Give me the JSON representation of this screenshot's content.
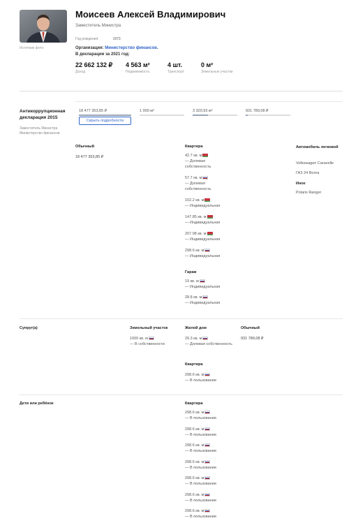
{
  "person": {
    "name": "Моисеев Алексей Владимирович",
    "position": "Заместитель Министра",
    "birth_label": "Год рождения:",
    "birth_year": "1973",
    "photo_caption": "Источник фото",
    "org_label": "Организация:",
    "org_name": "Министерство финансов",
    "org_suffix": ".",
    "decl_label": "В декларации за 2021 год:"
  },
  "summary": [
    {
      "value": "22 662 132 ₽",
      "label": "Доход"
    },
    {
      "value": "4 563 м²",
      "label": "Недвижимость"
    },
    {
      "value": "4 шт.",
      "label": "Транспорт"
    },
    {
      "value": "0 м²",
      "label": "Земельные участки"
    }
  ],
  "declaration": {
    "title": "Антикоррупционная декларация 2015",
    "position": "Заместитель Министра",
    "org": "Министерство финансов",
    "bars": [
      {
        "value": "18 477 353,85 ₽",
        "fill": 1.0
      },
      {
        "value": "1 000 м²",
        "fill": 0.0
      },
      {
        "value": "3 320,93 м²",
        "fill": 0.35
      },
      {
        "value": "931 789,08 ₽",
        "fill": 0.05
      }
    ],
    "toggle_button": "Скрыть подробности",
    "self": {
      "income_head": "Обычный",
      "income_value": "18 477 353,85 ₽",
      "apartments_head": "Квартира",
      "apartments": [
        {
          "area": "42.7 кв. м",
          "flag": "by",
          "type": "— Долевая собственность"
        },
        {
          "area": "57.7 кв. м",
          "flag": "ru",
          "type": "— Долевая собственность"
        },
        {
          "area": "102.2 кв. м",
          "flag": "by",
          "type": "— Индивидуальная"
        },
        {
          "area": "147.85 кв. м",
          "flag": "by",
          "type": "— Индивидуальная"
        },
        {
          "area": "207.98 кв. м",
          "flag": "by",
          "type": "— Индивидуальная"
        },
        {
          "area": "298.6 кв. м",
          "flag": "ru",
          "type": "— Индивидуальная"
        }
      ],
      "garage_head": "Гараж",
      "garages": [
        {
          "area": "19 кв. м",
          "flag": "ru",
          "type": "— Индивидуальная"
        },
        {
          "area": "28.8 кв. м",
          "flag": "ru",
          "type": "— Индивидуальная"
        }
      ],
      "vehicles_head": "Автомобиль легковой",
      "cars": [
        "Volkswagen Caravelle",
        "ГАЗ 24 Волга"
      ],
      "other_head": "Иное",
      "other": [
        "Polaris Ranger"
      ]
    },
    "spouse": {
      "label": "Супруг(а)",
      "land_head": "Земельный участок",
      "land": {
        "area": "1000 кв. м",
        "flag": "ru",
        "type": "— В собственности"
      },
      "house_head": "Жилой дом",
      "house": {
        "area": "29.3 кв. м",
        "flag": "ru",
        "type": "— Долевая собственность"
      },
      "apartment_head": "Квартира",
      "apartment": {
        "area": "298.6 кв. м",
        "flag": "ru",
        "type": "— В пользовании"
      },
      "income_head": "Обычный",
      "income_value": "931 789,08 ₽"
    },
    "children": {
      "label": "Дети или ребёнок",
      "apartment_head": "Квартира",
      "apartments": [
        {
          "area": "298.6 кв. м",
          "flag": "ru",
          "type": "— В пользовании"
        },
        {
          "area": "298.6 кв. м",
          "flag": "ru",
          "type": "— В пользовании"
        },
        {
          "area": "298.6 кв. м",
          "flag": "ru",
          "type": "— В пользовании"
        },
        {
          "area": "298.6 кв. м",
          "flag": "ru",
          "type": "— В пользовании"
        },
        {
          "area": "298.6 кв. м",
          "flag": "ru",
          "type": "— В пользовании"
        },
        {
          "area": "298.6 кв. м",
          "flag": "ru",
          "type": "— В пользовании"
        },
        {
          "area": "298.6 кв. м",
          "flag": "ru",
          "type": "— В пользовании"
        }
      ]
    }
  }
}
